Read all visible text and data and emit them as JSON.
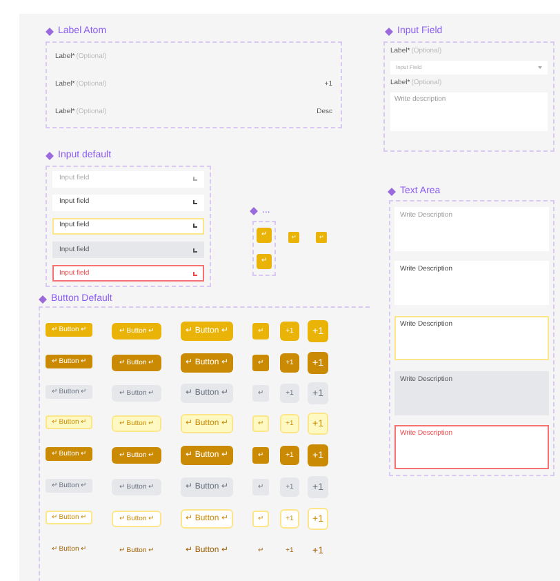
{
  "label_atom": {
    "title": "Label Atom",
    "rows": [
      {
        "label": "Label*",
        "optional": "(Optional)"
      },
      {
        "label": "Label*",
        "optional": "(Optional)",
        "trailing": "+1"
      },
      {
        "label": "Label*",
        "optional": "(Optional)",
        "trailing": "Desc"
      }
    ]
  },
  "input_field": {
    "title": "Input Field",
    "select_label": "Label*",
    "select_optional": "(Optional)",
    "select_value": "Input Field",
    "textarea_label": "Label*",
    "textarea_optional": "(Optional)",
    "textarea_placeholder": "Write description"
  },
  "input_default": {
    "title": "Input default",
    "rows": [
      {
        "kind": "placeholder",
        "text": "Input field"
      },
      {
        "kind": "filled",
        "text": "Input field"
      },
      {
        "kind": "focus",
        "text": "Input field"
      },
      {
        "kind": "disabled",
        "text": "Input field"
      },
      {
        "kind": "error",
        "text": "Input field"
      }
    ]
  },
  "icon_group": {
    "title": "...",
    "buttons": [
      "↵",
      "↵"
    ],
    "loose_buttons": [
      "↵",
      "↵"
    ]
  },
  "text_area": {
    "title": "Text Area",
    "rows": [
      {
        "kind": "placeholder",
        "text": "Write Description"
      },
      {
        "kind": "filled",
        "text": "Write Description"
      },
      {
        "kind": "focus",
        "text": "Write Description"
      },
      {
        "kind": "disabled",
        "text": "Write Description"
      },
      {
        "kind": "error",
        "text": "Write Description"
      }
    ]
  },
  "button_default": {
    "title": "Button Default",
    "rows": [
      {
        "kind": "primary",
        "labels": [
          "↵ Button ↵",
          "↵ Button ↵",
          "↵ Button ↵",
          "↵",
          "+1",
          "+1"
        ]
      },
      {
        "kind": "pressed",
        "labels": [
          "↵ Button ↵",
          "↵ Button ↵",
          "↵ Button ↵",
          "↵",
          "+1",
          "+1"
        ]
      },
      {
        "kind": "disabled",
        "labels": [
          "↵ Button ↵",
          "↵ Button ↵",
          "↵ Button ↵",
          "↵",
          "+1",
          "+1"
        ]
      },
      {
        "kind": "secondary",
        "labels": [
          "↵ Button ↵",
          "↵ Button ↵",
          "↵ Button ↵",
          "↵",
          "+1",
          "+1"
        ]
      },
      {
        "kind": "pressed",
        "labels": [
          "↵ Button ↵",
          "↵ Button ↵",
          "↵ Button ↵",
          "↵",
          "+1",
          "+1"
        ]
      },
      {
        "kind": "disabled",
        "labels": [
          "↵ Button ↵",
          "↵ Button ↵",
          "↵ Button ↵",
          "↵",
          "+1",
          "+1"
        ]
      },
      {
        "kind": "outline",
        "labels": [
          "↵ Button ↵",
          "↵ Button ↵",
          "↵ Button ↵",
          "↵",
          "+1",
          "+1"
        ]
      },
      {
        "kind": "ghost",
        "labels": [
          "↵ Button ↵",
          "↵ Button ↵",
          "↵ Button ↵",
          "↵",
          "+1",
          "+1"
        ]
      }
    ]
  }
}
